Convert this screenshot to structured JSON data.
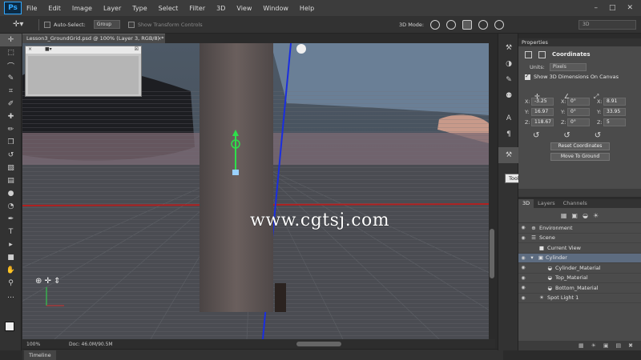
{
  "menubar": {
    "logo": "Ps",
    "items": [
      "File",
      "Edit",
      "Image",
      "Layer",
      "Type",
      "Select",
      "Filter",
      "3D",
      "View",
      "Window",
      "Help"
    ]
  },
  "options": {
    "auto_select_label": "Auto-Select:",
    "group_value": "Group",
    "show_transform_label": "Show Transform Controls",
    "mode_label": "3D Mode:",
    "workspace_value": "3D"
  },
  "document": {
    "tab_title": "Lesson3_GroundGrid.psd @ 100% (Layer 3, RGB/8) *",
    "watermark": "www.cgtsj.com"
  },
  "status": {
    "zoom": "100%",
    "doc_info": "Doc: 46.0M/90.5M",
    "timeline_label": "Timeline"
  },
  "tooltip": {
    "text": "Tool Presets"
  },
  "properties": {
    "panel_label": "Properties",
    "title": "Coordinates",
    "units_label": "Units:",
    "units_value": "Pixels",
    "show_dims_label": "Show 3D Dimensions On Canvas",
    "position": {
      "x": "-3.25",
      "y": "16.97",
      "z": "118.67"
    },
    "rotation": {
      "x": "0°",
      "y": "0°",
      "z": "0°"
    },
    "scale": {
      "x": "8.91",
      "y": "33.95",
      "z": "5"
    },
    "reset_button": "Reset Coordinates",
    "ground_button": "Move To Ground"
  },
  "layers": {
    "tabs": [
      "3D",
      "Layers",
      "Channels"
    ],
    "items": [
      {
        "name": "Environment"
      },
      {
        "name": "Scene"
      },
      {
        "name": "Current View"
      },
      {
        "name": "Cylinder"
      },
      {
        "name": "Cylinder_Material"
      },
      {
        "name": "Top_Material"
      },
      {
        "name": "Bottom_Material"
      },
      {
        "name": "Spot Light 1"
      }
    ]
  }
}
